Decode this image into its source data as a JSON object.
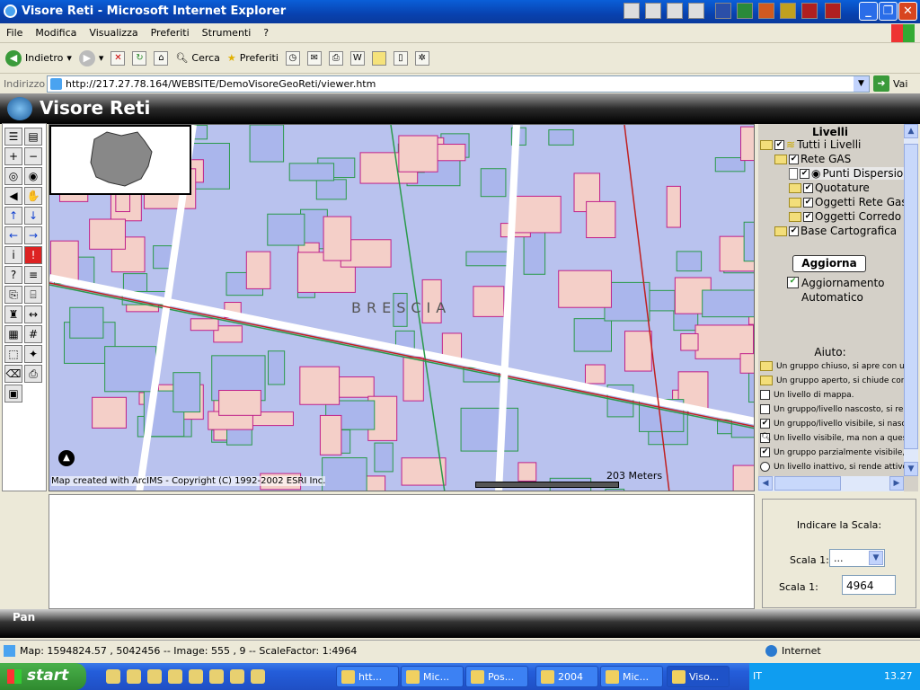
{
  "window": {
    "title": "Visore Reti - Microsoft Internet Explorer"
  },
  "menu": [
    "File",
    "Modifica",
    "Visualizza",
    "Preferiti",
    "Strumenti",
    "?"
  ],
  "toolbar": {
    "back": "Indietro",
    "search": "Cerca",
    "favorites": "Preferiti"
  },
  "address": {
    "label": "Indirizzo",
    "url": "http://217.27.78.164/WEBSITE/DemoVisoreGeoReti/viewer.htm",
    "go": "Vai"
  },
  "app": {
    "title": "Visore Reti"
  },
  "map": {
    "place_label": "BRESCIA",
    "scale_bar": "203 Meters",
    "copyright": "Map created with ArcIMS - Copyright (C) 1992-2002 ESRI Inc."
  },
  "layers": {
    "title": "Livelli",
    "items": [
      {
        "label": "Tutti i Livelli",
        "checked": true
      },
      {
        "label": "Rete GAS",
        "checked": true
      },
      {
        "label": "Punti Dispersione",
        "checked": true
      },
      {
        "label": "Quotature",
        "checked": true
      },
      {
        "label": "Oggetti Rete Gas",
        "checked": true
      },
      {
        "label": "Oggetti Corredo G",
        "checked": true
      },
      {
        "label": "Base Cartografica",
        "checked": true
      }
    ],
    "refresh_button": "Aggiorna",
    "auto_refresh_label": "Aggiornamento",
    "auto_refresh_label2": "Automatico",
    "auto_refresh": true
  },
  "help": {
    "title": "Aiuto:",
    "items": [
      "Un gruppo chiuso, si apre con un click",
      "Un gruppo aperto, si chiude con un click",
      "Un livello di mappa.",
      "Un gruppo/livello nascosto, si rende visibile",
      "Un gruppo/livello visibile, si nasconde",
      "Un livello visibile, ma non a questa scala",
      "Un gruppo parzialmente visibile, si",
      "Un livello inattivo, si rende attivo"
    ]
  },
  "scale": {
    "prompt": "Indicare la Scala:",
    "select_label": "Scala 1:",
    "select_value": "...",
    "input_label": "Scala 1:",
    "input_value": "4964"
  },
  "mode": "Pan",
  "status": {
    "text": "Map: 1594824.57 , 5042456 -- Image: 555 , 9 -- ScaleFactor: 1:4964",
    "zone": "Internet"
  },
  "taskbar": {
    "start": "start",
    "tasks": [
      "htt...",
      "Mic...",
      "Pos...",
      "2004",
      "Mic...",
      "Viso..."
    ],
    "lang": "IT",
    "clock": "13.27"
  }
}
